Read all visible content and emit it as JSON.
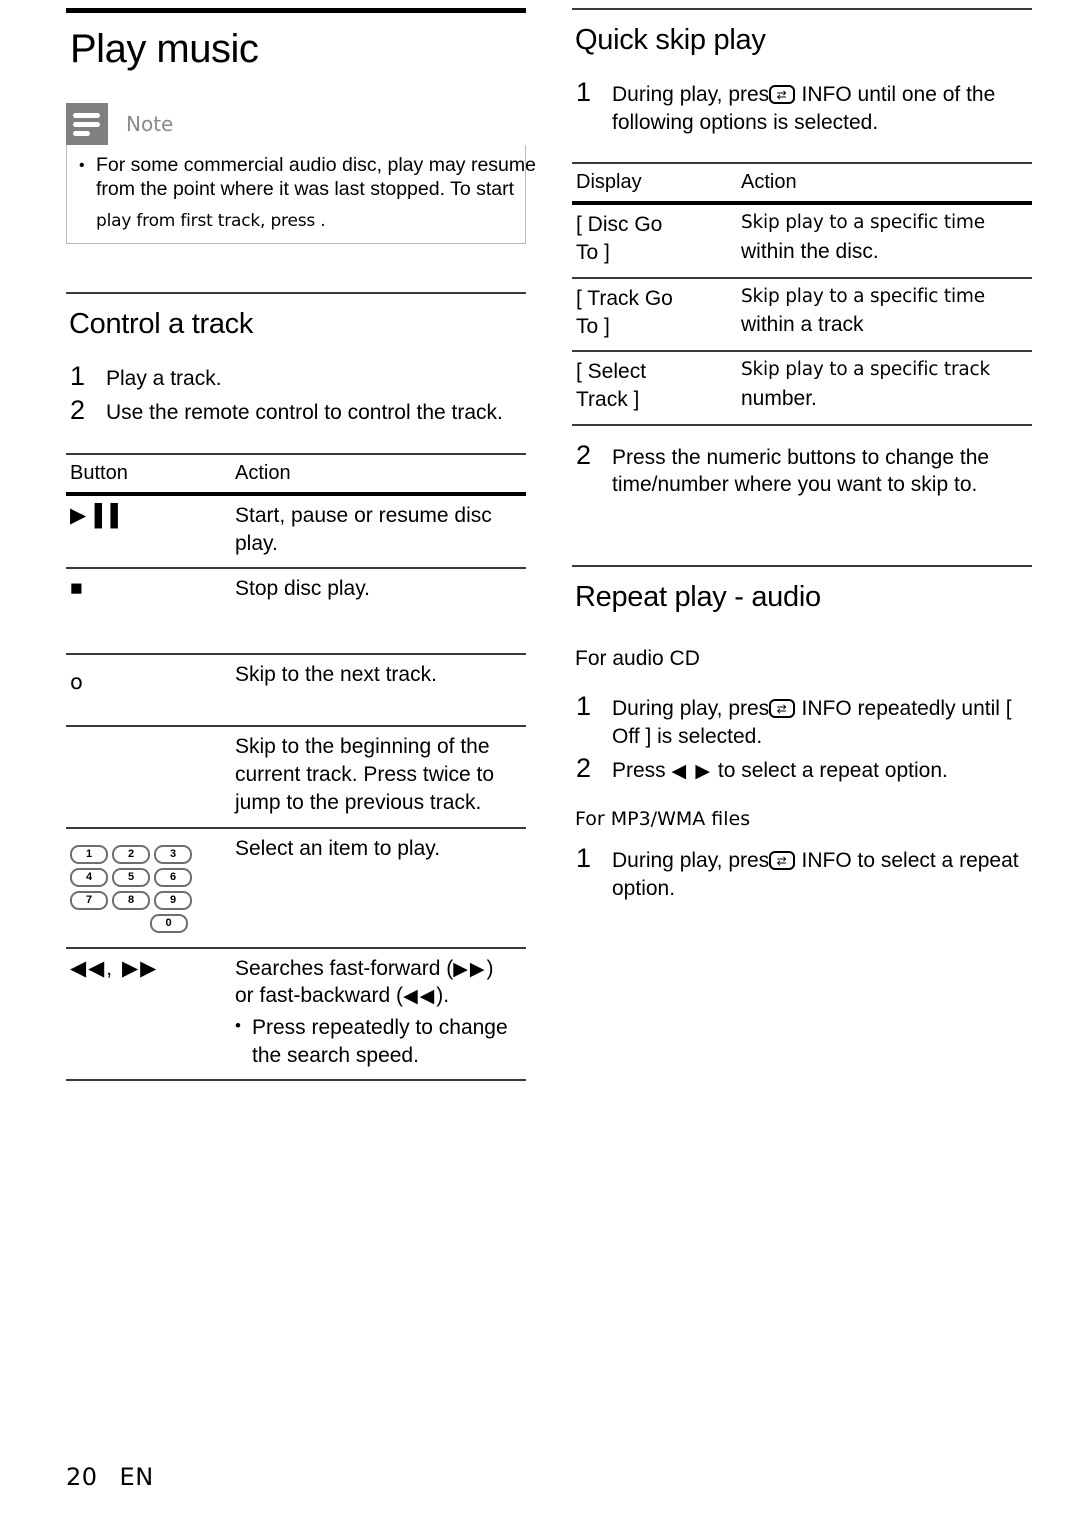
{
  "document": {
    "page_number": "20",
    "language_code": "EN"
  },
  "left_column": {
    "page_title": "Play music",
    "note": {
      "label": "Note",
      "icon": "note-lines-icon",
      "bullet": "•",
      "text_line1": "For some commercial audio disc, play may resume",
      "text_line2": "from the point where it was last stopped. To start",
      "text_line3": "play from first track, press          ."
    },
    "control_track": {
      "title": "Control a track",
      "steps": [
        {
          "num": "1",
          "text": "Play a track."
        },
        {
          "num": "2",
          "text": "Use the remote control to control the track."
        }
      ],
      "table": {
        "headers": {
          "button": "Button",
          "action": "Action"
        },
        "rows": [
          {
            "button_glyph": "▶▐▐",
            "button_kind": "playpause",
            "action": "Start, pause or resume disc play."
          },
          {
            "button_glyph": "■",
            "button_kind": "stop",
            "action": "Stop disc play."
          },
          {
            "button_glyph": "ᴏ",
            "button_kind": "skip-next-missing-glyph",
            "action": "Skip to the next track."
          },
          {
            "button_glyph": "",
            "button_kind": "skip-prev-blank",
            "action": "Skip to the beginning of the current track. Press twice to jump to the previous track."
          },
          {
            "button_glyph": "",
            "button_kind": "numeric-keypad",
            "action": "Select an item to play.",
            "keypad": {
              "rows": [
                [
                  "1",
                  "2",
                  "3"
                ],
                [
                  "4",
                  "5",
                  "6"
                ],
                [
                  "7",
                  "8",
                  "9"
                ]
              ],
              "zero": "0"
            }
          },
          {
            "button_glyph": "◀◀, ▶▶",
            "button_kind": "search-fwd-rev",
            "action_line1": "Searches fast-forward (",
            "action_glyph1": "▶▶",
            "action_line1b": ")",
            "action_line2": "or fast-backward (",
            "action_glyph2": "◀◀",
            "action_line2b": ").",
            "sub_bullet": "•",
            "sub_text": "Press repeatedly to change the search speed."
          }
        ]
      }
    }
  },
  "right_column": {
    "quick_skip": {
      "title": "Quick skip play",
      "step1": {
        "num": "1",
        "text_before": "During play, press",
        "icon": "info-screen-icon",
        "text_after": " INFO until one of the following options is selected."
      },
      "table": {
        "headers": {
          "display": "Display",
          "action": "Action"
        },
        "rows": [
          {
            "display_line1": "[ Disc Go",
            "display_line2": "To ]",
            "action_thin": "Skip play to a specific time",
            "action_bold": "within the disc."
          },
          {
            "display_line1": "[ Track Go",
            "display_line2": "To ]",
            "action_thin": "Skip play to a specific time",
            "action_bold": "within a track"
          },
          {
            "display_line1": "[ Select",
            "display_line2": "Track ]",
            "action_thin": "Skip play to a specific track",
            "action_bold": "number."
          }
        ]
      },
      "step2": {
        "num": "2",
        "text": "Press the numeric buttons to change the time/number where you want to skip to."
      }
    },
    "repeat_play": {
      "title": "Repeat play - audio",
      "audio_cd_label": "For audio CD",
      "audio_cd_steps": [
        {
          "num": "1",
          "text_before": "During play, press",
          "icon": "info-screen-icon",
          "text_after": " INFO repeatedly until [ Off ] is selected."
        },
        {
          "num": "2",
          "text_before": "Press ",
          "arrows": "◀ ▶",
          "text_after": " to select a repeat option."
        }
      ],
      "mp3_label": "For MP3/WMA files",
      "mp3_steps": [
        {
          "num": "1",
          "text_before": "During play, press",
          "icon": "info-screen-icon",
          "text_after": " INFO to select a repeat option."
        }
      ]
    }
  },
  "colors": {
    "note_icon_bg": "#808080",
    "note_label": "#8a8a8a",
    "note_border": "#b9b9b9",
    "rule": "#3a3a3a",
    "text": "#000000"
  }
}
